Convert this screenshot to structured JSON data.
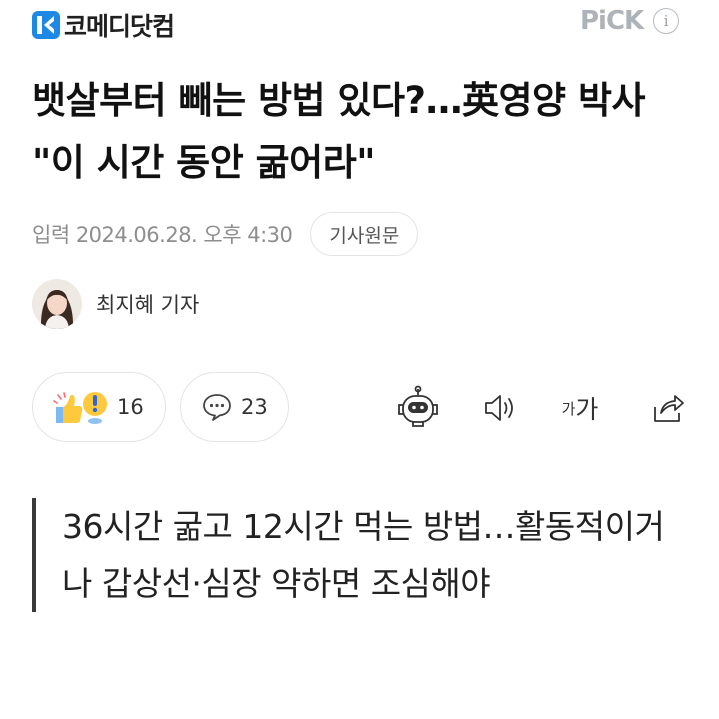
{
  "header": {
    "brand": "코메디닷컴",
    "pick_label": "PiCK",
    "info_glyph": "i"
  },
  "article": {
    "title": "뱃살부터 빼는 방법 있다?…英영양 박사 \"이 시간 동안 굶어라\"",
    "date": "입력 2024.06.28. 오후 4:30",
    "original_button": "기사원문",
    "reporter": "최지혜 기자",
    "summary": "36시간 굶고 12시간 먹는 방법…활동적이거나 갑상선·심장 약하면 조심해야"
  },
  "actions": {
    "reaction_count": "16",
    "comment_count": "23",
    "font_small": "가",
    "font_big": "가"
  },
  "colors": {
    "brand_blue": "#1e88e5",
    "brand_dark": "#1a3a8f",
    "muted": "#8e8e8e"
  }
}
